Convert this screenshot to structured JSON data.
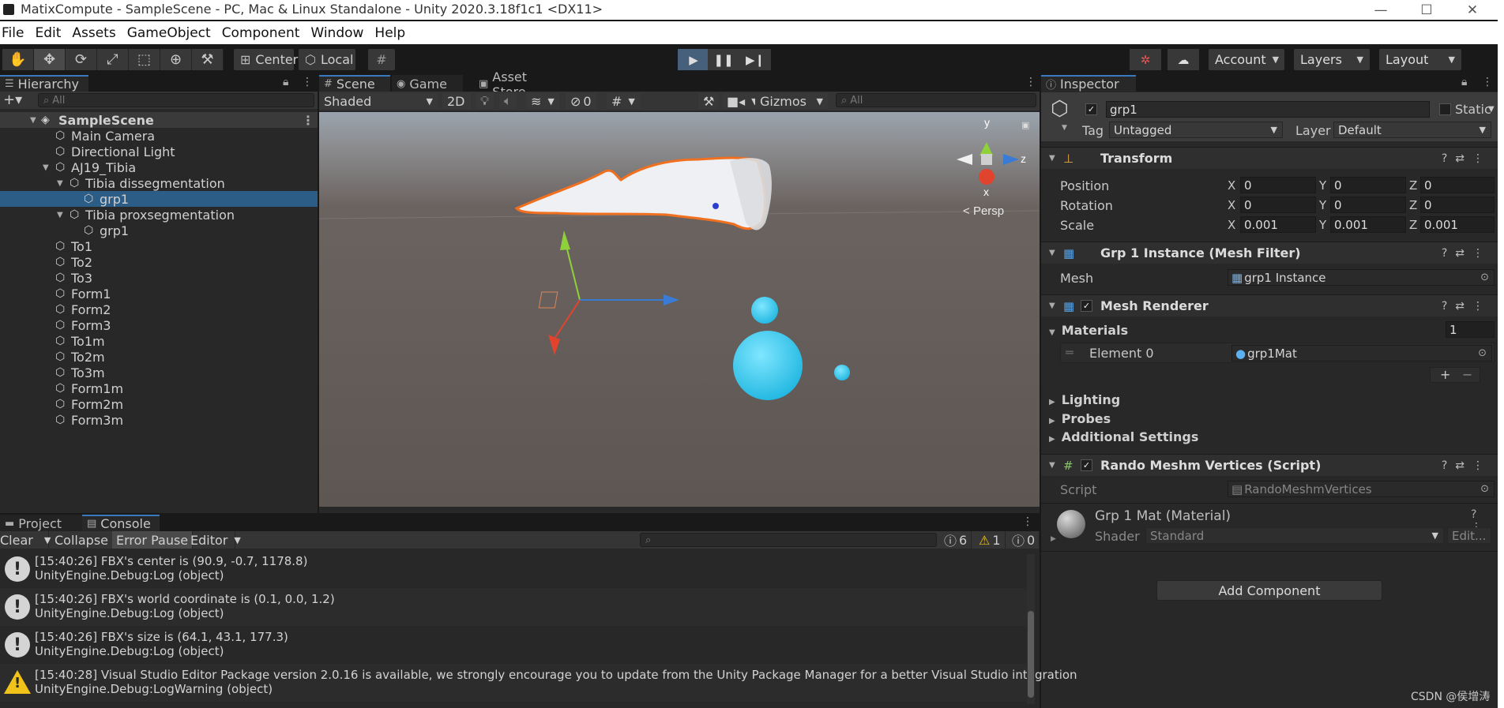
{
  "window": {
    "title": "MatixCompute - SampleScene - PC, Mac & Linux Standalone - Unity 2020.3.18f1c1 <DX11>",
    "controls": {
      "minimize": "—",
      "maximize": "☐",
      "close": "✕"
    }
  },
  "menu": [
    "File",
    "Edit",
    "Assets",
    "GameObject",
    "Component",
    "Window",
    "Help"
  ],
  "toolbar": {
    "tools": [
      "hand-icon",
      "move-icon",
      "rotate-icon",
      "scale-icon",
      "rect-icon",
      "transform-icon",
      "custom-tool-icon"
    ],
    "pivot": "Center",
    "space": "Local",
    "account": "Account",
    "layers": "Layers",
    "layout": "Layout"
  },
  "hierarchy": {
    "tab": "Hierarchy",
    "search_placeholder": "All",
    "scene": "SampleScene",
    "items": [
      "Main Camera",
      "Directional Light",
      "AJ19_Tibia",
      "Tibia dissegmentation",
      "grp1",
      "Tibia proxsegmentation",
      "grp1",
      "To1",
      "To2",
      "To3",
      "Form1",
      "Form2",
      "Form3",
      "To1m",
      "To2m",
      "To3m",
      "Form1m",
      "Form2m",
      "Form3m"
    ]
  },
  "scene_view": {
    "tabs": [
      "Scene",
      "Game",
      "Asset Store"
    ],
    "shading": "Shaded",
    "mode_2d": "2D",
    "hidden_count": "0",
    "gizmos": "Gizmos",
    "search_placeholder": "All",
    "gizmo": {
      "y": "y",
      "z": "z",
      "x": "x",
      "persp": "Persp"
    }
  },
  "inspector": {
    "tab": "Inspector",
    "object_name": "grp1",
    "static_label": "Static",
    "tag_label": "Tag",
    "tag_value": "Untagged",
    "layer_label": "Layer",
    "layer_value": "Default",
    "transform": {
      "title": "Transform",
      "position_label": "Position",
      "position": [
        "0",
        "0",
        "0"
      ],
      "rotation_label": "Rotation",
      "rotation": [
        "0",
        "0",
        "0"
      ],
      "scale_label": "Scale",
      "scale": [
        "0.001",
        "0.001",
        "0.001"
      ],
      "axes": [
        "X",
        "Y",
        "Z"
      ]
    },
    "mesh_filter": {
      "title": "Grp 1 Instance (Mesh Filter)",
      "mesh_label": "Mesh",
      "mesh_value": "grp1 Instance"
    },
    "mesh_renderer": {
      "title": "Mesh Renderer",
      "materials_label": "Materials",
      "materials_count": "1",
      "element_label": "Element 0",
      "element_value": "grp1Mat",
      "add": "+",
      "remove": "−",
      "lighting": "Lighting",
      "probes": "Probes",
      "additional": "Additional Settings"
    },
    "script": {
      "title": "Rando Meshm Vertices (Script)",
      "script_label": "Script",
      "script_value": "RandoMeshmVertices"
    },
    "material": {
      "title": "Grp 1 Mat (Material)",
      "shader_label": "Shader",
      "shader_value": "Standard",
      "edit": "Edit..."
    },
    "add_component": "Add Component"
  },
  "console": {
    "tabs": [
      "Project",
      "Console"
    ],
    "buttons": {
      "clear": "Clear",
      "collapse": "Collapse",
      "error_pause": "Error Pause",
      "editor": "Editor"
    },
    "counts": {
      "info": "6",
      "warn": "1",
      "error": "0"
    },
    "logs": [
      {
        "type": "info",
        "line1": "[15:40:26] FBX's center is (90.9, -0.7, 1178.8)",
        "line2": "UnityEngine.Debug:Log (object)"
      },
      {
        "type": "info",
        "line1": "[15:40:26] FBX's world coordinate is (0.1, 0.0, 1.2)",
        "line2": "UnityEngine.Debug:Log (object)"
      },
      {
        "type": "info",
        "line1": "[15:40:26] FBX's size is (64.1, 43.1, 177.3)",
        "line2": "UnityEngine.Debug:Log (object)"
      },
      {
        "type": "warn",
        "line1": "[15:40:28] Visual Studio Editor Package version 2.0.16 is available, we strongly encourage you to update from the Unity Package Manager for a better Visual Studio integration",
        "line2": "UnityEngine.Debug:LogWarning (object)"
      }
    ]
  },
  "watermark": "CSDN @侯增涛",
  "colors": {
    "selection": "#2c5d87",
    "accent_tab": "#3a79bb",
    "sphere": "#3fd0f0",
    "outline": "#f07020"
  }
}
